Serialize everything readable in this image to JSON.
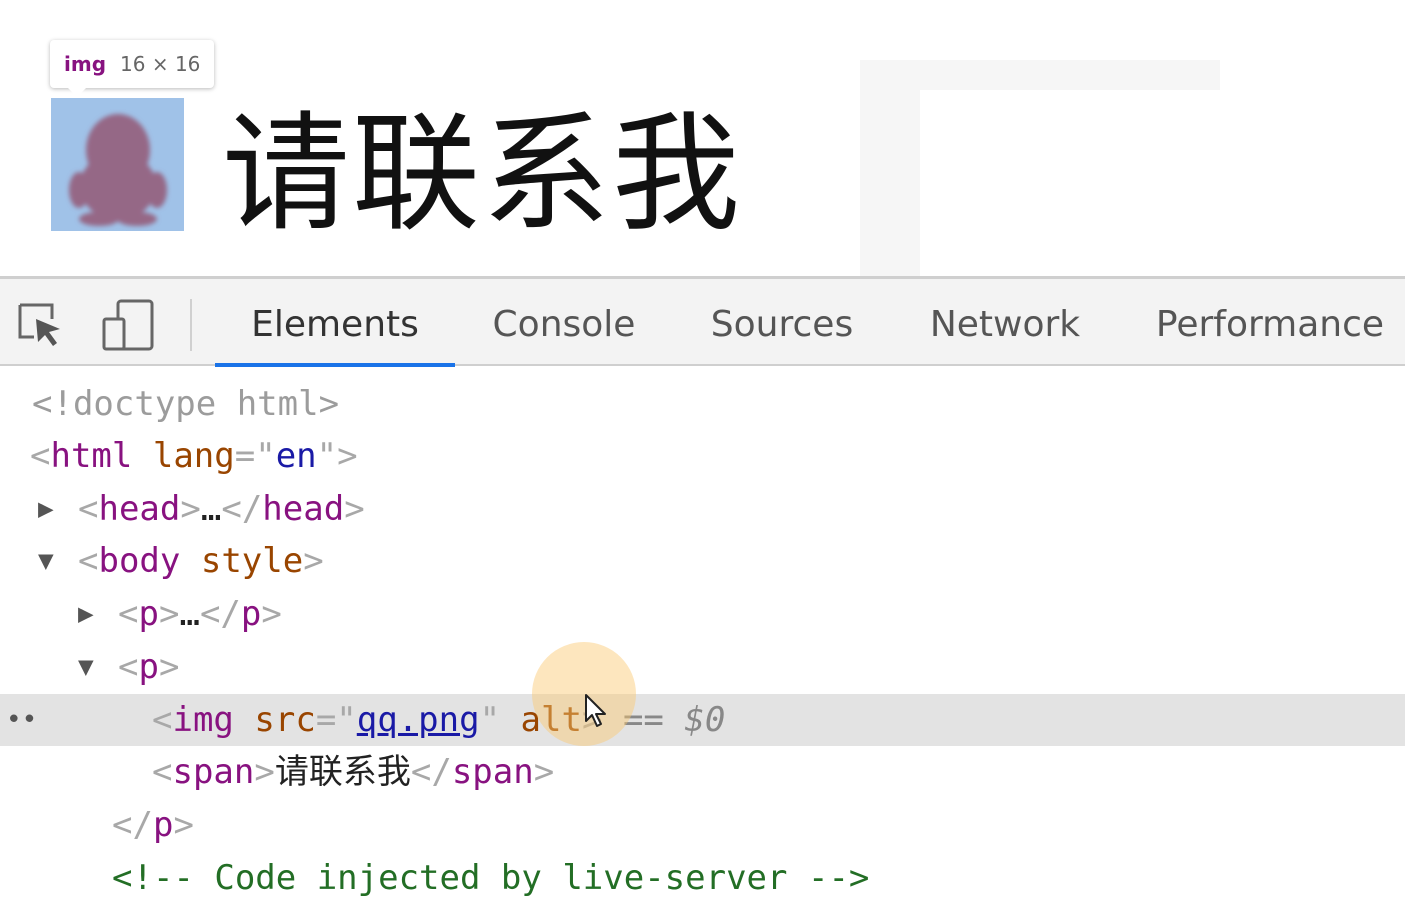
{
  "preview": {
    "tooltip": {
      "tag": "img",
      "size": "16 × 16"
    },
    "heading": "请联系我",
    "image_icon": "qq-penguin-icon"
  },
  "devtools": {
    "tools": [
      {
        "name": "inspect-element-icon"
      },
      {
        "name": "device-toolbar-icon"
      }
    ],
    "tabs": [
      "Elements",
      "Console",
      "Sources",
      "Network",
      "Performance"
    ],
    "active_tab": "Elements",
    "accent_color": "#1a73e8"
  },
  "dom_tree": {
    "doctype": "<!doctype html>",
    "html": {
      "tag": "html",
      "attr": "lang",
      "value": "en"
    },
    "head": {
      "tag": "head",
      "ellipsis": "…"
    },
    "body": {
      "tag": "body",
      "attr": "style"
    },
    "p1": {
      "tag": "p",
      "ellipsis": "…"
    },
    "p2": {
      "tag": "p"
    },
    "img": {
      "tag": "img",
      "src_attr": "src",
      "src_value": "qq.png",
      "alt_attr": "alt",
      "marker": "== $0"
    },
    "span": {
      "tag": "span",
      "text": "请联系我"
    },
    "comment": "<!-- Code injected by live-server -->"
  }
}
